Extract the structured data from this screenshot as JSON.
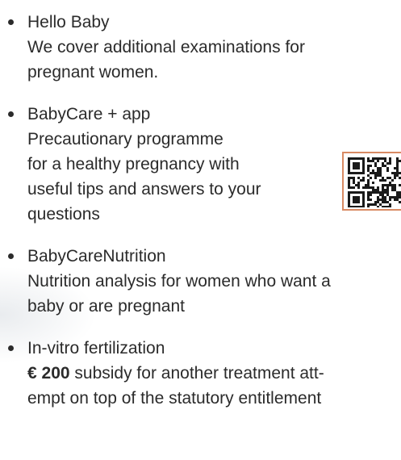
{
  "benefits": [
    {
      "title": "Hello Baby",
      "desc": [
        "We cover additional examinations for",
        "pregnant women."
      ]
    },
    {
      "title": "BabyCare + app",
      "desc": [
        "Precautionary programme",
        "for a healthy pregnancy with",
        "useful tips and answers to your",
        "questions"
      ]
    },
    {
      "title": "BabyCareNutrition",
      "desc": [
        "Nutrition analysis for women who want a",
        "baby or are pregnant"
      ]
    },
    {
      "title": "In-vitro fertilization",
      "amount": "€ 200",
      "desc": [
        " subsidy for another treatment att-",
        "empt on top of the statutory entitlement"
      ]
    }
  ],
  "qr": {
    "icon": "qr-code-icon",
    "border_color": "#d88a63"
  }
}
